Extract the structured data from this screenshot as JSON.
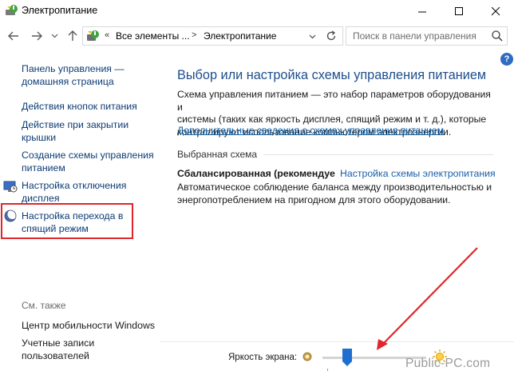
{
  "window": {
    "title": "Электропитание",
    "icon": "power-options-icon"
  },
  "nav": {
    "address": {
      "overflow": "«",
      "crumb1": "Все элементы ...",
      "crumb2": "Электропитание"
    },
    "search_placeholder": "Поиск в панели управления"
  },
  "sidebar": {
    "items": [
      {
        "label_line1": "Панель управления —",
        "label_line2": "домашняя страница"
      },
      {
        "label_line1": "Действия кнопок питания"
      },
      {
        "label_line1": "Действие при закрытии",
        "label_line2": "крышки"
      },
      {
        "label_line1": "Создание схемы управления",
        "label_line2": "питанием"
      },
      {
        "label_line1": "Настройка отключения",
        "label_line2": "дисплея"
      },
      {
        "label_line1": "Настройка перехода в",
        "label_line2": "спящий режим"
      }
    ],
    "see_also": "См. также",
    "see_also_items": [
      {
        "label_line1": "Центр мобильности Windows"
      },
      {
        "label_line1": "Учетные записи",
        "label_line2": "пользователей"
      }
    ]
  },
  "main": {
    "heading": "Выбор или настройка схемы управления питанием",
    "description_lines": [
      "Схема управления питанием — это набор параметров оборудования и",
      "системы (таких как яркость дисплея, спящий режим и т. д.), которые",
      "контролируют использование компьютером электроэнергии."
    ],
    "description_link": "Дополнительные сведения о схемах управления питанием",
    "section_label": "Выбранная схема",
    "plan_name": "Сбалансированная (рекомендуе",
    "plan_settings_link": "Настройка схемы электропитания",
    "plan_desc_lines": [
      "Автоматическое соблюдение баланса между производительностью и",
      "энергопотреблением на пригодном для этого оборудовании."
    ]
  },
  "brightness": {
    "label": "Яркость экрана:",
    "value_fraction": 0.24
  },
  "watermark": "Public-PC.com",
  "colors": {
    "link": "#0d3c74",
    "heading": "#1e4e8c",
    "highlight_box": "#e0262b",
    "arrow": "#e0262b"
  }
}
